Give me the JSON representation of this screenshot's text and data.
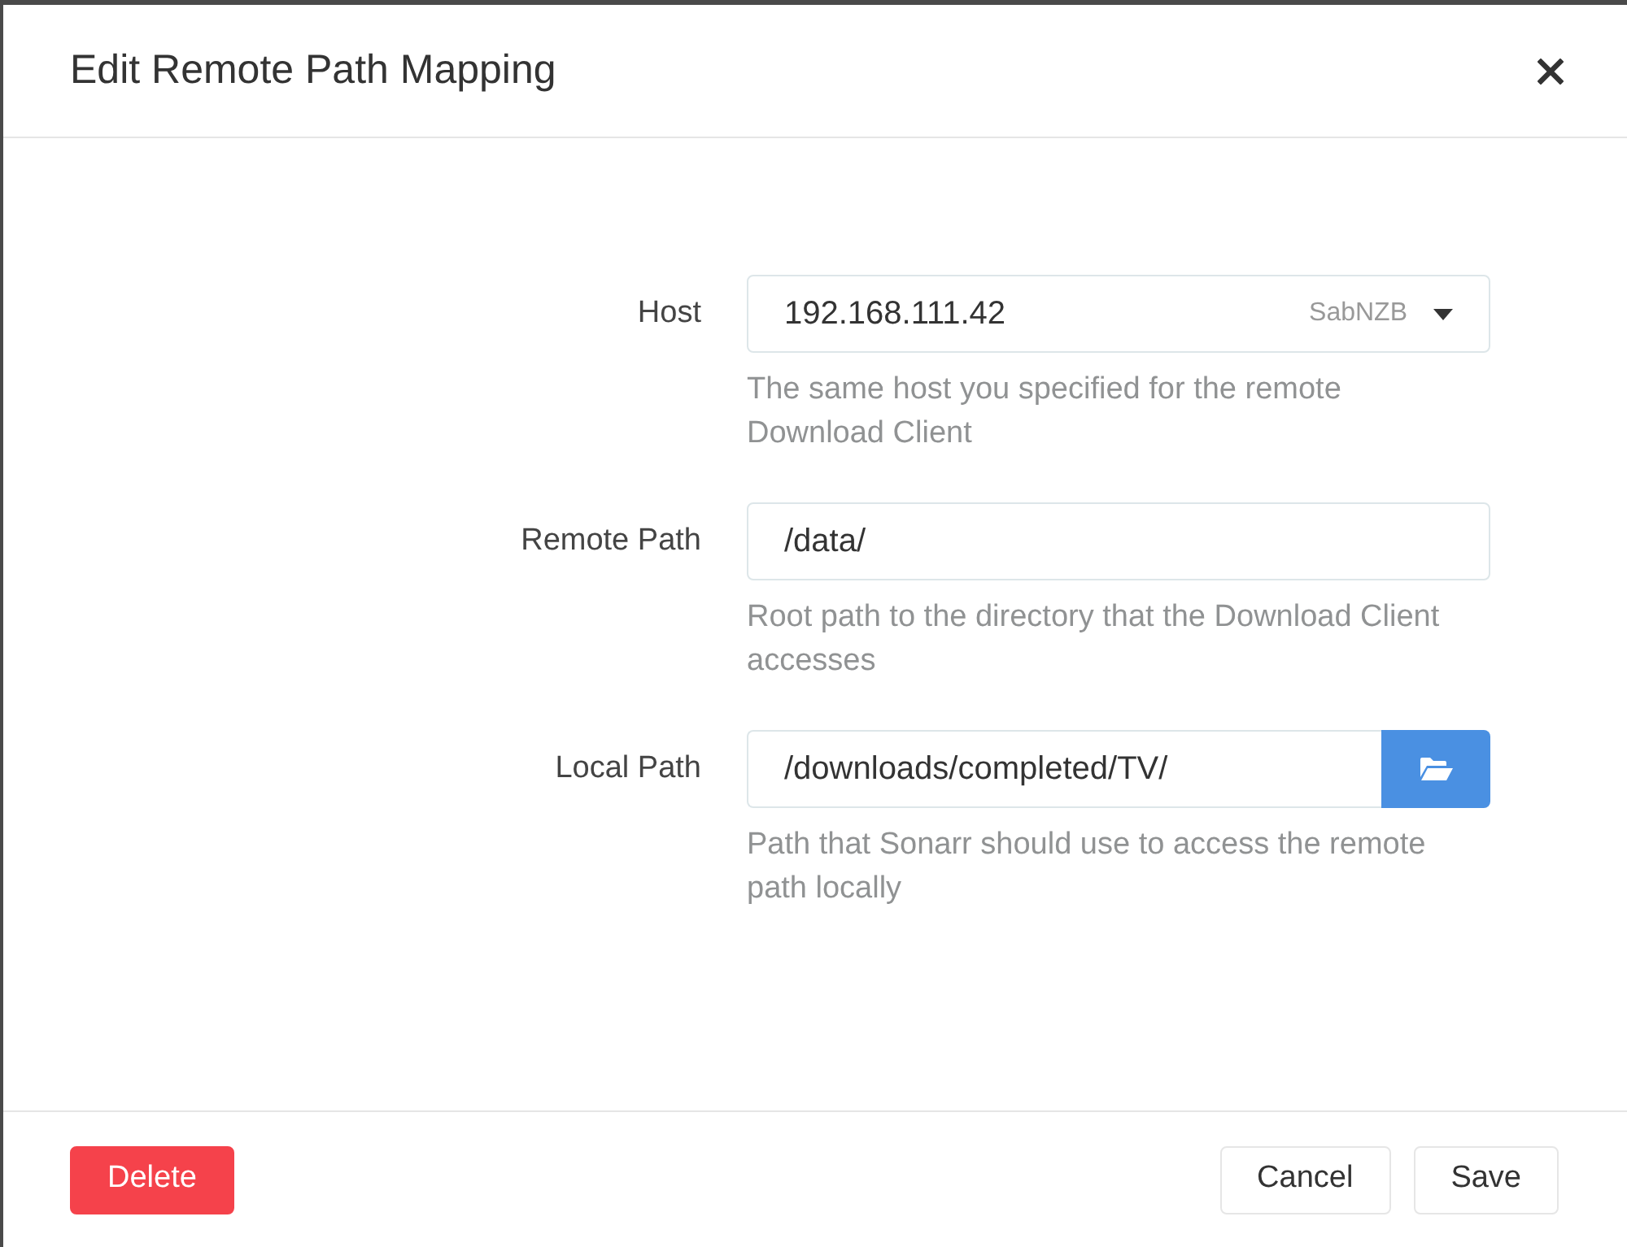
{
  "dialog": {
    "title": "Edit Remote Path Mapping"
  },
  "fields": [
    {
      "kind": "select",
      "label": "Host",
      "value": "192.168.111.42",
      "hint": "SabNZB",
      "help": "The same host you specified for the remote Download Client"
    },
    {
      "kind": "text",
      "label": "Remote Path",
      "value": "/data/",
      "help": "Root path to the directory that the Download Client accesses"
    },
    {
      "kind": "path",
      "label": "Local Path",
      "value": "/downloads/completed/TV/",
      "help": "Path that Sonarr should use to access the remote path locally"
    }
  ],
  "footer": {
    "buttons": [
      {
        "kind": "danger",
        "label": "Delete"
      },
      {
        "kind": "default",
        "label": "Cancel"
      },
      {
        "kind": "default",
        "label": "Save"
      }
    ]
  }
}
